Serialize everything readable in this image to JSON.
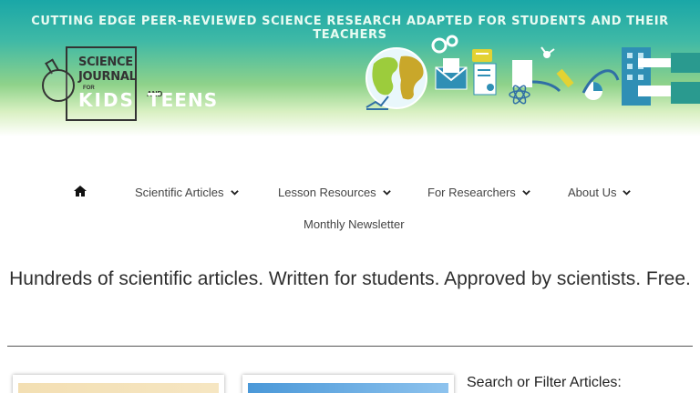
{
  "header": {
    "tagline": "CUTTING EDGE PEER-REVIEWED SCIENCE RESEARCH ADAPTED FOR STUDENTS AND THEIR TEACHERS",
    "logo": {
      "line1": "SCIENCE",
      "line2": "JOURNAL",
      "for_text": "FOR",
      "kids": "KIDS",
      "and_text": "AND",
      "teens": "TEENS"
    }
  },
  "nav": {
    "home_icon": "home-icon",
    "items": [
      {
        "label": "Scientific Articles",
        "has_dropdown": true
      },
      {
        "label": "Lesson Resources",
        "has_dropdown": true
      },
      {
        "label": "For Researchers",
        "has_dropdown": true
      },
      {
        "label": "About Us",
        "has_dropdown": true
      },
      {
        "label": "Monthly Newsletter",
        "has_dropdown": false
      }
    ]
  },
  "main": {
    "headline": "Hundreds of scientific articles. Written for students. Approved by scientists. Free.",
    "search_title": "Search or Filter Articles:"
  },
  "colors": {
    "banner_top": "#1aa7a7",
    "banner_mid": "#8fd28a",
    "text": "#333333"
  }
}
